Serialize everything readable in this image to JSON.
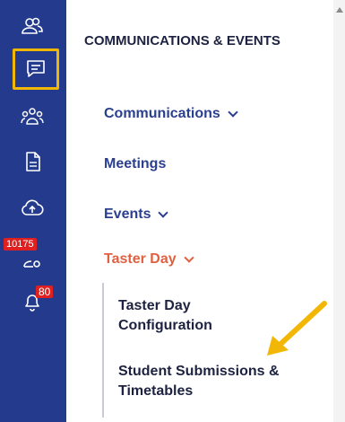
{
  "rail": {
    "background": "#243a8c",
    "items": [
      {
        "icon": "users-icon",
        "active": false,
        "badge": null
      },
      {
        "icon": "chat-icon",
        "active": true,
        "badge": null
      },
      {
        "icon": "group-icon",
        "active": false,
        "badge": null
      },
      {
        "icon": "document-icon",
        "active": false,
        "badge": null
      },
      {
        "icon": "cloud-upload-icon",
        "active": false,
        "badge": null
      },
      {
        "icon": "student-settings-icon",
        "active": false,
        "badge": "10175"
      },
      {
        "icon": "bell-icon",
        "active": false,
        "badge": "80"
      }
    ],
    "active_highlight": "#f2b705"
  },
  "panel": {
    "title": "COMMUNICATIONS & EVENTS",
    "nav": [
      {
        "label": "Communications",
        "expandable": true,
        "active": false
      },
      {
        "label": "Meetings",
        "expandable": false,
        "active": false
      },
      {
        "label": "Events",
        "expandable": true,
        "active": false
      },
      {
        "label": "Taster Day",
        "expandable": true,
        "active": true
      }
    ],
    "submenu": [
      {
        "label_line1": "Taster Day",
        "label_line2": "Configuration"
      },
      {
        "label_line1": "Student Submissions &",
        "label_line2": "Timetables"
      }
    ],
    "colors": {
      "nav": "#2a3f8f",
      "active": "#e06040",
      "annotation_arrow": "#f2b705"
    }
  }
}
